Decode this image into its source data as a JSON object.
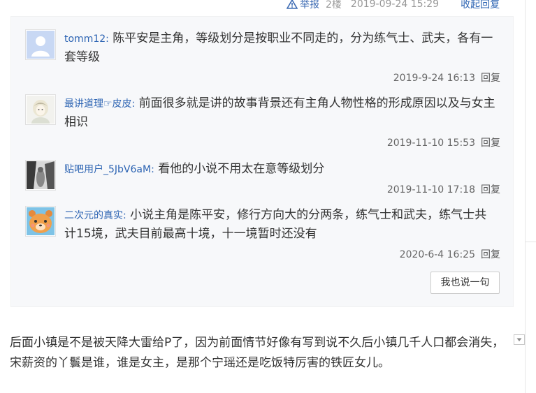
{
  "post_header": {
    "report_label": "举报",
    "floor": "2楼",
    "time": "2019-09-24 15:29",
    "fold_label": "收起回复"
  },
  "replies": [
    {
      "username": "tomm12:",
      "text": "陈平安是主角，等级划分是按职业不同走的，分为练气士、武夫，各有一套等级",
      "time": "2019-9-24 16:13",
      "reply_label": "回复",
      "avatar_icon": "default-user-avatar"
    },
    {
      "username": "最讲道理☞皮皮:",
      "text": "前面很多就是讲的故事背景还有主角人物性格的形成原因以及与女主相识",
      "time": "2019-11-10 15:53",
      "reply_label": "回复",
      "avatar_icon": "anime-girl-avatar"
    },
    {
      "username": "贴吧用户_5JbV6aM:",
      "text": "看他的小说不用太在意等级划分",
      "time": "2019-11-10 17:18",
      "reply_label": "回复",
      "avatar_icon": "dark-photo-avatar"
    },
    {
      "username": "二次元的真实:",
      "text": "小说主角是陈平安，修行方向大的分两条，练气士和武夫，练气士共计15境，武夫目前最高十境，十一境暂时还没有",
      "time": "2020-6-4 16:25",
      "reply_label": "回复",
      "avatar_icon": "orange-bear-avatar"
    }
  ],
  "say_button_label": "我也说一句",
  "next_post_text": "后面小镇是不是被天降大雷给P了，因为前面情节好像有写到说不久后小镇几千人口都会消失，宋薪资的丫鬟是谁，谁是女主，是那个宁瑶还是吃饭特厉害的铁匠女儿。",
  "colors": {
    "link_blue": "#2d64b3",
    "reply_box_bg": "#f7f8fa"
  }
}
